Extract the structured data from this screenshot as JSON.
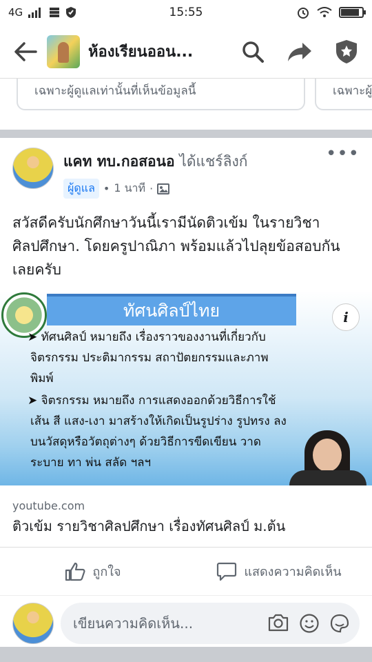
{
  "status_bar": {
    "network": "4G",
    "time": "15:55",
    "battery_level": 0.85
  },
  "app_bar": {
    "title": "ห้องเรียนออน..."
  },
  "previous_cards": [
    {
      "text": "เฉพาะผู้ดูแลเท่านั้นที่เห็นข้อมูลนี้"
    },
    {
      "text": "เฉพาะผู้"
    }
  ],
  "post": {
    "author": "แคท ทบ.กอสอนอ",
    "shared_text": "ได้แชร์ลิงก์",
    "badge": "ผู้ดูแล",
    "time": "1 นาที",
    "body": "สวัสดีครับนักศึกษาวันนี้เรามีนัดติวเข้ม ในรายวิชาศิลปศึกษา. โดยครูปาณิภา  พร้อมแล้วไปลุยข้อสอบกันเลยครับ",
    "preview": {
      "banner": "ทัศนศิลป์ไทย",
      "line1": "➤ ทัศนศิลป์ หมายถึง เรื่องราวของงานที่เกี่ยวกับ",
      "line2": "จิตรกรรม ประติมากรรม สถาปัตยกรรมและภาพ",
      "line3": "พิมพ์",
      "line4": "➤ จิตรกรรม หมายถึง การแสดงออกด้วยวิธีการใช้",
      "line5": "เส้น สี แสง-เงา มาสร้างให้เกิดเป็นรูปร่าง รูปทรง ลง",
      "line6": "บนวัสดุหรือวัตถุต่างๆ ด้วยวิธีการขีดเขียน วาด",
      "line7": "ระบาย ทา พ่น สลัด ฯลฯ",
      "info_label": "i"
    },
    "link_domain": "youtube.com",
    "link_title": "ติวเข้ม รายวิชาศิลปศึกษา เรื่องทัศนศิลป์ ม.ต้น"
  },
  "actions": {
    "like": "ถูกใจ",
    "comment": "แสดงความคิดเห็น"
  },
  "comment": {
    "placeholder": "เขียนความคิดเห็น..."
  },
  "colors": {
    "accent": "#1877f2",
    "divider": "#c9ccd1",
    "slide_banner": "#5ea4e8"
  }
}
